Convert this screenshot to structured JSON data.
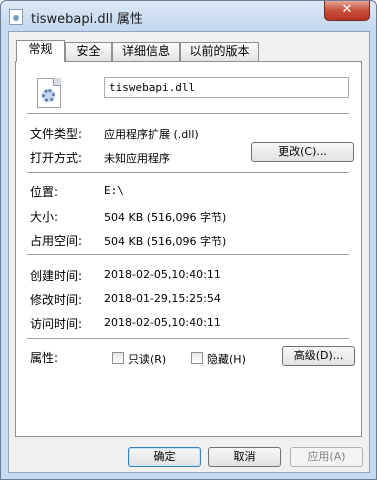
{
  "window": {
    "title": "tiswebapi.dll 属性",
    "close_glyph": "✕"
  },
  "tabs": [
    {
      "label": "常规",
      "active": true
    },
    {
      "label": "安全",
      "active": false
    },
    {
      "label": "详细信息",
      "active": false
    },
    {
      "label": "以前的版本",
      "active": false
    }
  ],
  "general": {
    "file_icon": "dll-file-icon",
    "file_name": "tiswebapi.dll",
    "file_type_label": "文件类型:",
    "file_type_value": "应用程序扩展 (.dll)",
    "opens_with_label": "打开方式:",
    "opens_with_value": "未知应用程序",
    "change_button": "更改(C)...",
    "location_label": "位置:",
    "location_value": "E:\\",
    "size_label": "大小:",
    "size_value": "504 KB (516,096 字节)",
    "size_on_disk_label": "占用空间:",
    "size_on_disk_value": "504 KB (516,096 字节)",
    "created_label": "创建时间:",
    "created_value": "2018-02-05,10:40:11",
    "modified_label": "修改时间:",
    "modified_value": "2018-01-29,15:25:54",
    "accessed_label": "访问时间:",
    "accessed_value": "2018-02-05,10:40:11",
    "attributes_label": "属性:",
    "readonly_label": "只读(R)",
    "readonly_checked": false,
    "hidden_label": "隐藏(H)",
    "hidden_checked": false,
    "advanced_button": "高级(D)..."
  },
  "footer": {
    "ok_button": "确定",
    "cancel_button": "取消",
    "apply_button": "应用(A)"
  },
  "colors": {
    "titlebar": "#c3d7ee",
    "close_button": "#c7503b",
    "client_bg": "#f0f0f0"
  }
}
